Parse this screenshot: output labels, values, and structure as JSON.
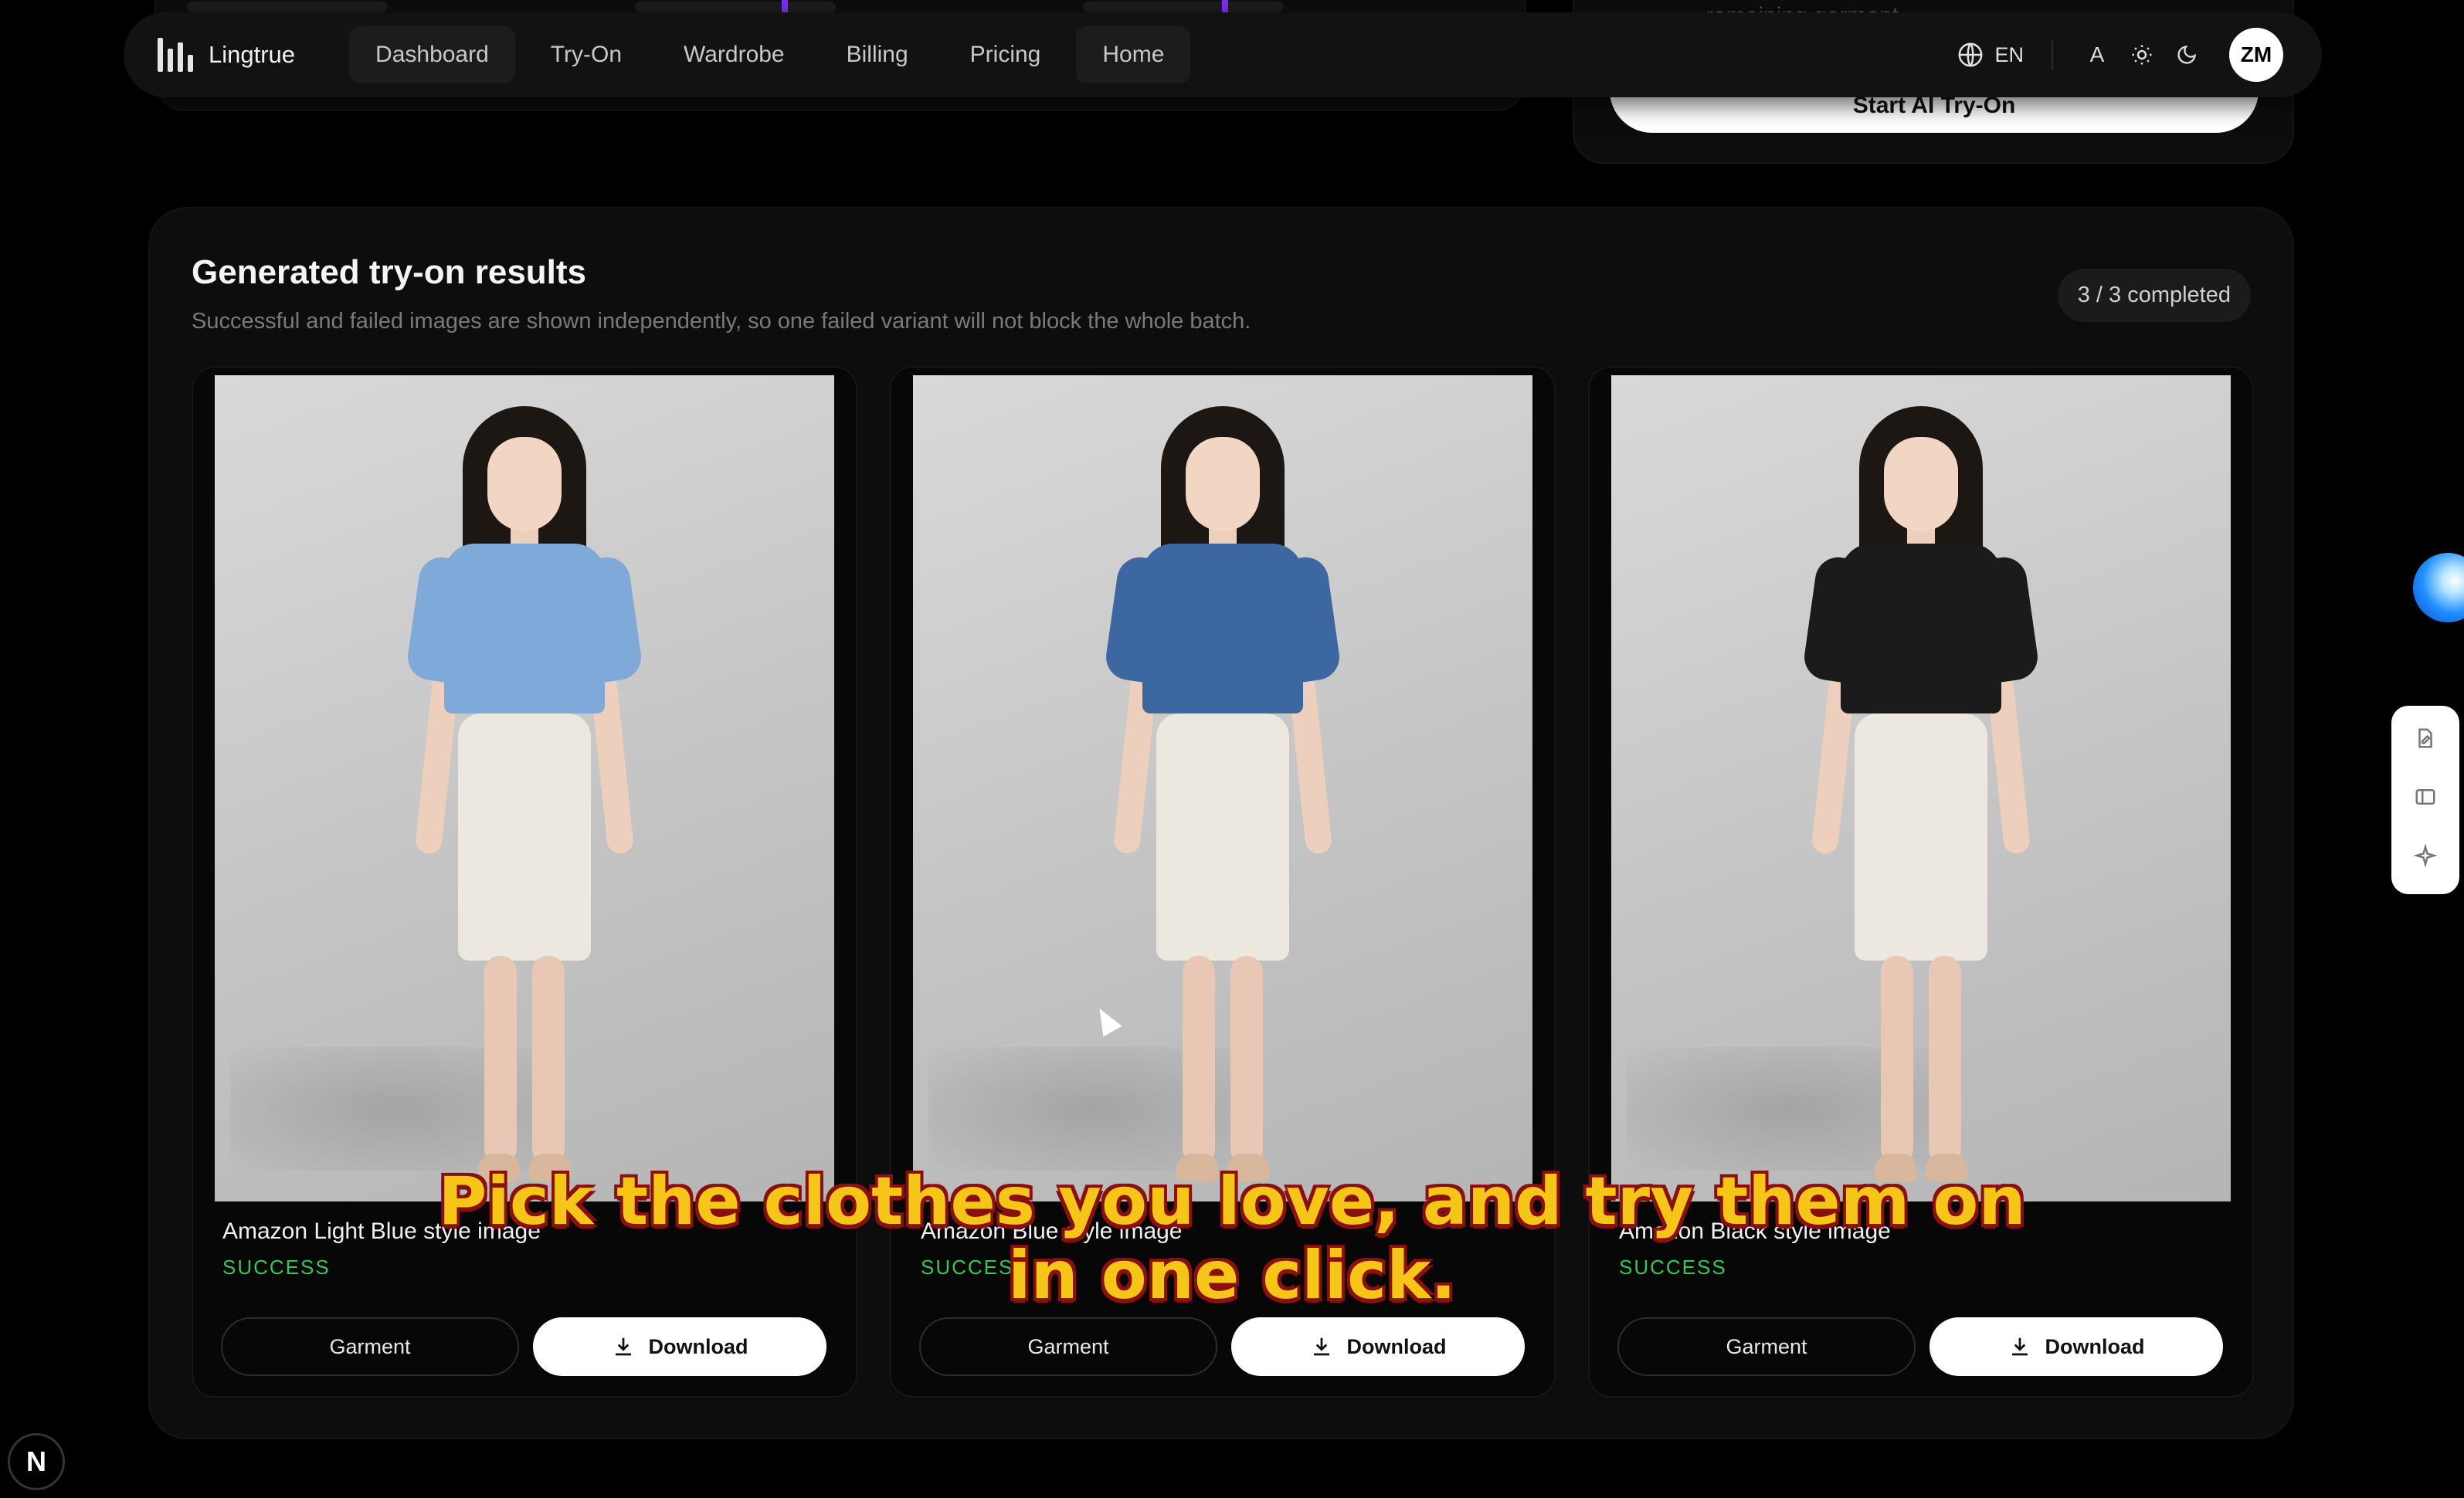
{
  "navbar": {
    "brand": "Lingtrue",
    "links": [
      {
        "label": "Dashboard"
      },
      {
        "label": "Try-On"
      },
      {
        "label": "Wardrobe"
      },
      {
        "label": "Billing"
      },
      {
        "label": "Pricing"
      },
      {
        "label": "Home"
      }
    ],
    "language": "EN",
    "font_toggle": "A",
    "avatar_initials": "ZM"
  },
  "top_panel": {
    "faded_text": "remaining garment.",
    "start_button": "Start AI Try-On"
  },
  "results": {
    "title": "Generated try-on results",
    "description": "Successful and failed images are shown independently, so one failed variant will not block the whole batch.",
    "status_pill": "3 / 3 completed",
    "cards": [
      {
        "title": "Amazon Light Blue style image",
        "status": "SUCCESS",
        "garment_button": "Garment",
        "download_button": "Download",
        "shirt_color": "#7ea9d8"
      },
      {
        "title": "Amazon Blue style image",
        "status": "SUCCESS",
        "garment_button": "Garment",
        "download_button": "Download",
        "shirt_color": "#3c67a1"
      },
      {
        "title": "Amazon Black style image",
        "status": "SUCCESS",
        "garment_button": "Garment",
        "download_button": "Download",
        "shirt_color": "#1b1b1b"
      }
    ]
  },
  "subtitle": {
    "line1": "Pick the clothes you love, and try them on",
    "line2": "in one click."
  },
  "next_badge": "N",
  "colors": {
    "background": "#000000",
    "panel": "#0d0d0d",
    "success": "#34c759",
    "subtitle_fill": "#f5c518",
    "subtitle_stroke": "#8a1010"
  }
}
